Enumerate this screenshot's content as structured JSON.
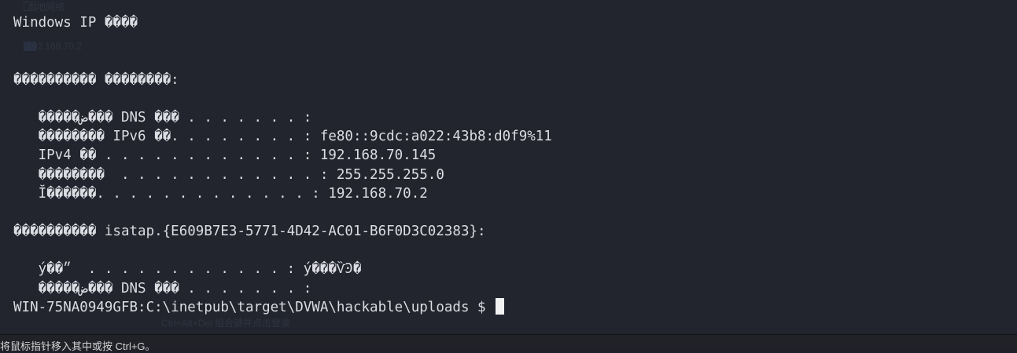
{
  "terminal": {
    "lines": [
      "Windows IP ����",
      "",
      "",
      "���������� ��������:",
      "",
      "   �����ض��� DNS ��� . . . . . . . :",
      "   �������� IPv6 ��. . . . . . . . : fe80::9cdc:a022:43b8:d0f9%11",
      "   IPv4 �� . . . . . . . . . . . . : 192.168.70.145",
      "   ��������  . . . . . . . . . . . . : 255.255.255.0",
      "   Ĭ������. . . . . . . . . . . . . : 192.168.70.2",
      "",
      "���������� isatap.{E609B7E3-5771-4D42-AC01-B6F0D3C02383}:",
      "",
      "   ý��״  . . . . . . . . . . . . : ý���ѶϿ�",
      "   �����ض��� DNS ��� . . . . . . . :"
    ],
    "prompt": "WIN-75NA0949GFB:C:\\inetpub\\target\\DVWA\\hackable\\uploads $ "
  },
  "background_ghost": {
    "text_1": "本地网络",
    "text_2": "192.168.70.2",
    "text_3": "Ctrl+Alt+Del 组合键并点击登录"
  },
  "statusbar": {
    "text": "将鼠标指针移入其中或按 Ctrl+G。"
  },
  "colors": {
    "terminal_bg": "#22252e",
    "terminal_fg": "#dcdde2",
    "statusbar_bg": "#202228"
  }
}
